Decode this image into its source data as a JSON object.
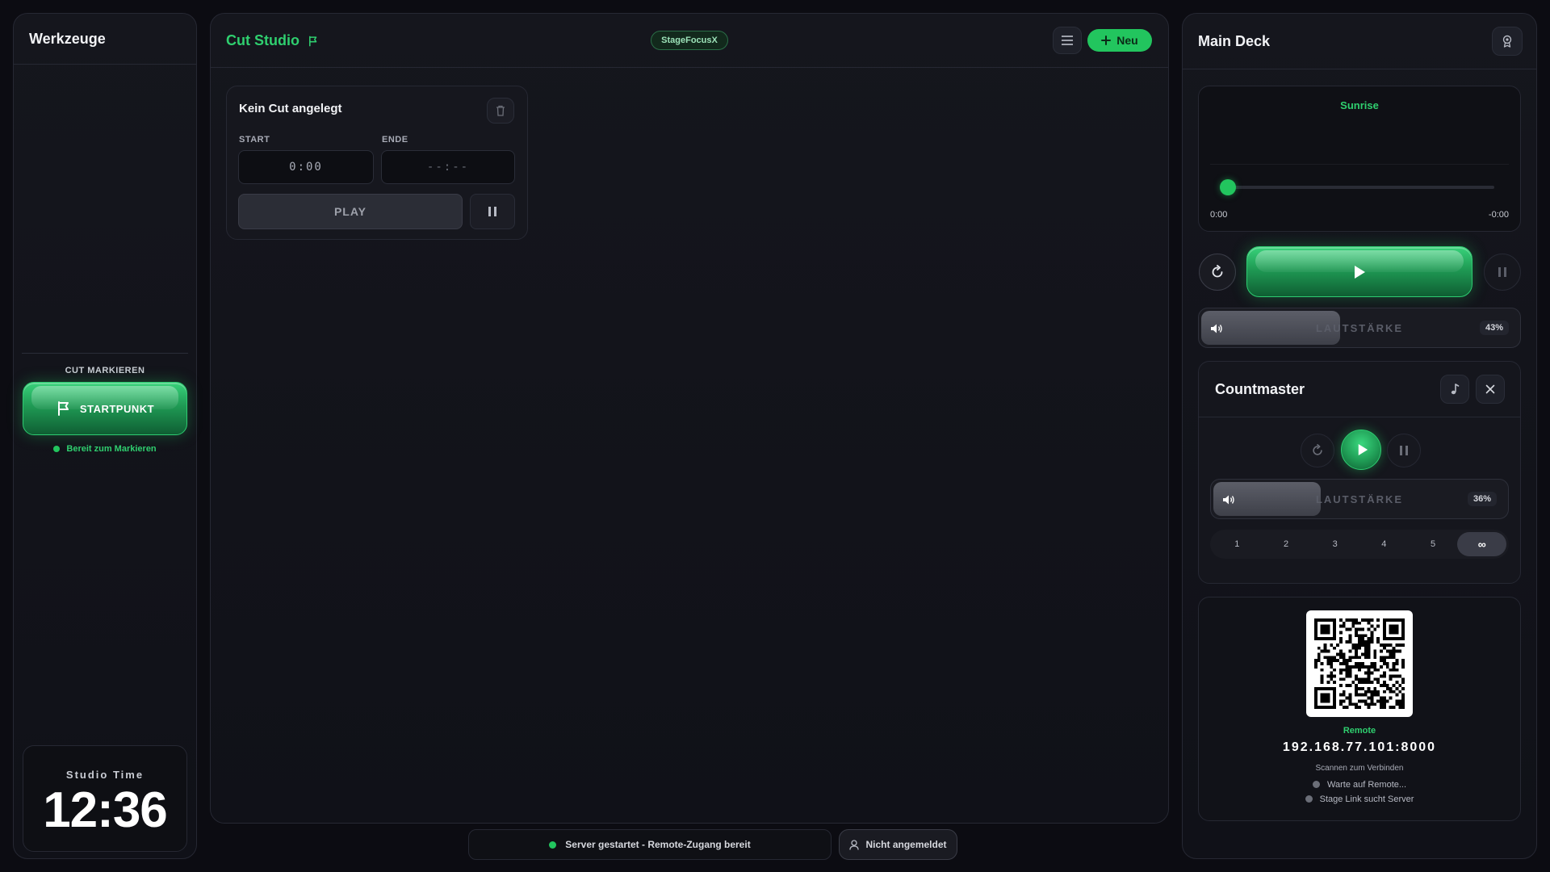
{
  "left": {
    "title": "Werkzeuge",
    "section_label": "CUT MARKIEREN",
    "startpunkt_label": "STARTPUNKT",
    "ready_text": "Bereit zum Markieren",
    "studio_time_label": "Studio Time",
    "clock": "12:36"
  },
  "center": {
    "title": "Cut Studio",
    "badge": "StageFocusX",
    "new_label": "Neu",
    "cut": {
      "title": "Kein Cut angelegt",
      "start_label": "START",
      "end_label": "ENDE",
      "start_value": "0:00",
      "end_value": "--:--",
      "play_label": "PLAY"
    }
  },
  "status": {
    "server_text": "Server gestartet - Remote-Zugang bereit",
    "login_text": "Nicht angemeldet"
  },
  "right": {
    "title": "Main Deck",
    "track_name": "Sunrise",
    "elapsed": "0:00",
    "remaining": "-0:00",
    "progress": 0,
    "volume_label": "LAUTSTÄRKE",
    "volume_pct": "43%",
    "countmaster": {
      "title": "Countmaster",
      "volume_label": "LAUTSTÄRKE",
      "volume_pct": "36%",
      "tabs": [
        "1",
        "2",
        "3",
        "4",
        "5",
        "∞"
      ],
      "active_tab": 5
    },
    "remote": {
      "label": "Remote",
      "address": "192.168.77.101:8000",
      "hint": "Scannen zum Verbinden",
      "status1": "Warte auf Remote...",
      "status2": "Stage Link sucht Server"
    }
  },
  "colors": {
    "accent": "#22c55e",
    "accent_text": "#2fcf6f",
    "dot_gray": "#6b6e78"
  }
}
